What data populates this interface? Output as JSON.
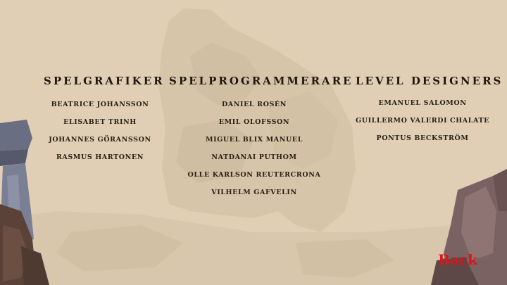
{
  "credits": {
    "columns": [
      {
        "heading": "SPELGRAFIKER",
        "names": [
          "BEATRICE JOHANSSON",
          "ELISABET TRINH",
          "JOHANNES GÖRANSSON",
          "RASMUS HARTONEN"
        ]
      },
      {
        "heading": "SPELPROGRAMMERARE",
        "names": [
          "DANIEL ROSÉN",
          "EMIL OLOFSSON",
          "MIGUEL BLIX MANUEL",
          "NATDANAI PUTHOM",
          "OLLE KARLSON REUTERCRONA",
          "VILHELM GAFVELIN"
        ]
      },
      {
        "heading": "LEVEL DESIGNERS",
        "names": [
          "EMANUEL SALOMON",
          "GUILLERMO VALERDI CHALATE",
          "PONTUS BECKSTRÖM"
        ]
      }
    ]
  },
  "navigation": {
    "back_label": "Back"
  },
  "colors": {
    "background": "#e0cfb4",
    "text": "#2a2018",
    "back_accent": "#d8171a"
  }
}
